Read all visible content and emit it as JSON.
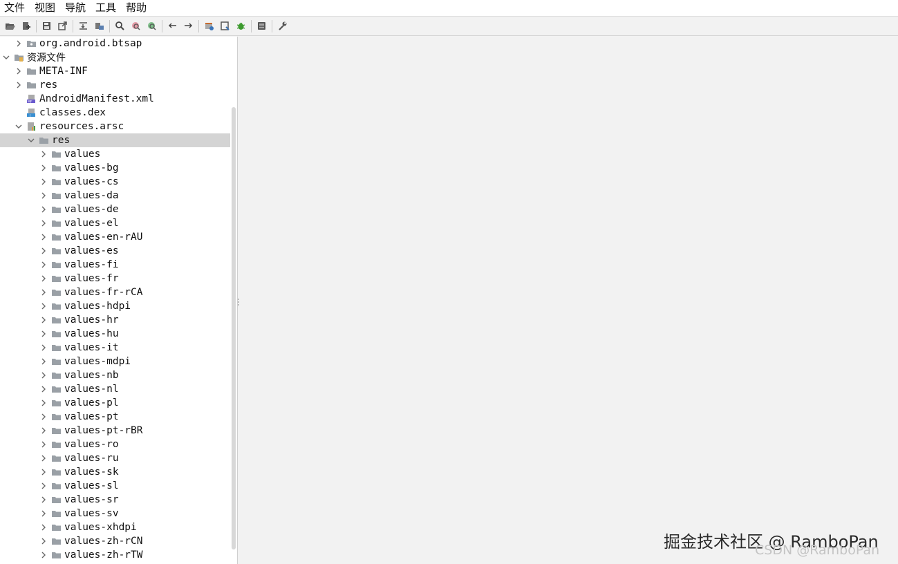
{
  "menu": [
    {
      "label": "文件"
    },
    {
      "label": "视图"
    },
    {
      "label": "导航"
    },
    {
      "label": "工具"
    },
    {
      "label": "帮助"
    }
  ],
  "toolbar": {
    "groups": [
      [
        "open-icon",
        "add-files-icon"
      ],
      [
        "save-icon",
        "export-icon"
      ],
      [
        "sync-tree-icon",
        "flatten-packages-icon"
      ],
      [
        "search-icon",
        "find-class-icon",
        "find-usage-icon"
      ],
      [
        "back-icon",
        "forward-icon"
      ],
      [
        "deobfuscation-icon",
        "quick-preview-icon",
        "debug-icon"
      ],
      [
        "log-icon"
      ],
      [
        "preferences-icon"
      ]
    ]
  },
  "tree": {
    "rows": [
      {
        "label": "org.android.btsap",
        "level": 1,
        "expander": "collapsed",
        "icon": "package-icon"
      },
      {
        "label": "资源文件",
        "level": 0,
        "expander": "expanded",
        "icon": "resources-icon",
        "cjk": true
      },
      {
        "label": "META-INF",
        "level": 1,
        "expander": "collapsed",
        "icon": "folder-icon"
      },
      {
        "label": "res",
        "level": 1,
        "expander": "collapsed",
        "icon": "folder-icon"
      },
      {
        "label": "AndroidManifest.xml",
        "level": 1,
        "expander": "none",
        "icon": "manifest-file-icon"
      },
      {
        "label": "classes.dex",
        "level": 1,
        "expander": "none",
        "icon": "dex-file-icon"
      },
      {
        "label": "resources.arsc",
        "level": 1,
        "expander": "expanded",
        "icon": "arsc-file-icon"
      },
      {
        "label": "res",
        "level": 2,
        "expander": "expanded",
        "icon": "folder-icon",
        "selected": true
      },
      {
        "label": "values",
        "level": 3,
        "expander": "collapsed",
        "icon": "folder-icon"
      },
      {
        "label": "values-bg",
        "level": 3,
        "expander": "collapsed",
        "icon": "folder-icon"
      },
      {
        "label": "values-cs",
        "level": 3,
        "expander": "collapsed",
        "icon": "folder-icon"
      },
      {
        "label": "values-da",
        "level": 3,
        "expander": "collapsed",
        "icon": "folder-icon"
      },
      {
        "label": "values-de",
        "level": 3,
        "expander": "collapsed",
        "icon": "folder-icon"
      },
      {
        "label": "values-el",
        "level": 3,
        "expander": "collapsed",
        "icon": "folder-icon"
      },
      {
        "label": "values-en-rAU",
        "level": 3,
        "expander": "collapsed",
        "icon": "folder-icon"
      },
      {
        "label": "values-es",
        "level": 3,
        "expander": "collapsed",
        "icon": "folder-icon"
      },
      {
        "label": "values-fi",
        "level": 3,
        "expander": "collapsed",
        "icon": "folder-icon"
      },
      {
        "label": "values-fr",
        "level": 3,
        "expander": "collapsed",
        "icon": "folder-icon"
      },
      {
        "label": "values-fr-rCA",
        "level": 3,
        "expander": "collapsed",
        "icon": "folder-icon"
      },
      {
        "label": "values-hdpi",
        "level": 3,
        "expander": "collapsed",
        "icon": "folder-icon"
      },
      {
        "label": "values-hr",
        "level": 3,
        "expander": "collapsed",
        "icon": "folder-icon"
      },
      {
        "label": "values-hu",
        "level": 3,
        "expander": "collapsed",
        "icon": "folder-icon"
      },
      {
        "label": "values-it",
        "level": 3,
        "expander": "collapsed",
        "icon": "folder-icon"
      },
      {
        "label": "values-mdpi",
        "level": 3,
        "expander": "collapsed",
        "icon": "folder-icon"
      },
      {
        "label": "values-nb",
        "level": 3,
        "expander": "collapsed",
        "icon": "folder-icon"
      },
      {
        "label": "values-nl",
        "level": 3,
        "expander": "collapsed",
        "icon": "folder-icon"
      },
      {
        "label": "values-pl",
        "level": 3,
        "expander": "collapsed",
        "icon": "folder-icon"
      },
      {
        "label": "values-pt",
        "level": 3,
        "expander": "collapsed",
        "icon": "folder-icon"
      },
      {
        "label": "values-pt-rBR",
        "level": 3,
        "expander": "collapsed",
        "icon": "folder-icon"
      },
      {
        "label": "values-ro",
        "level": 3,
        "expander": "collapsed",
        "icon": "folder-icon"
      },
      {
        "label": "values-ru",
        "level": 3,
        "expander": "collapsed",
        "icon": "folder-icon"
      },
      {
        "label": "values-sk",
        "level": 3,
        "expander": "collapsed",
        "icon": "folder-icon"
      },
      {
        "label": "values-sl",
        "level": 3,
        "expander": "collapsed",
        "icon": "folder-icon"
      },
      {
        "label": "values-sr",
        "level": 3,
        "expander": "collapsed",
        "icon": "folder-icon"
      },
      {
        "label": "values-sv",
        "level": 3,
        "expander": "collapsed",
        "icon": "folder-icon"
      },
      {
        "label": "values-xhdpi",
        "level": 3,
        "expander": "collapsed",
        "icon": "folder-icon"
      },
      {
        "label": "values-zh-rCN",
        "level": 3,
        "expander": "collapsed",
        "icon": "folder-icon"
      },
      {
        "label": "values-zh-rTW",
        "level": 3,
        "expander": "collapsed",
        "icon": "folder-icon"
      }
    ]
  },
  "watermark": {
    "line1": "掘金技术社区 @ RamboPan",
    "line2": "CSDN @RamboPan"
  },
  "colors": {
    "selection": "#d4d4d4",
    "folder": "#9aa0a6",
    "debug": "#3c9a2e"
  }
}
